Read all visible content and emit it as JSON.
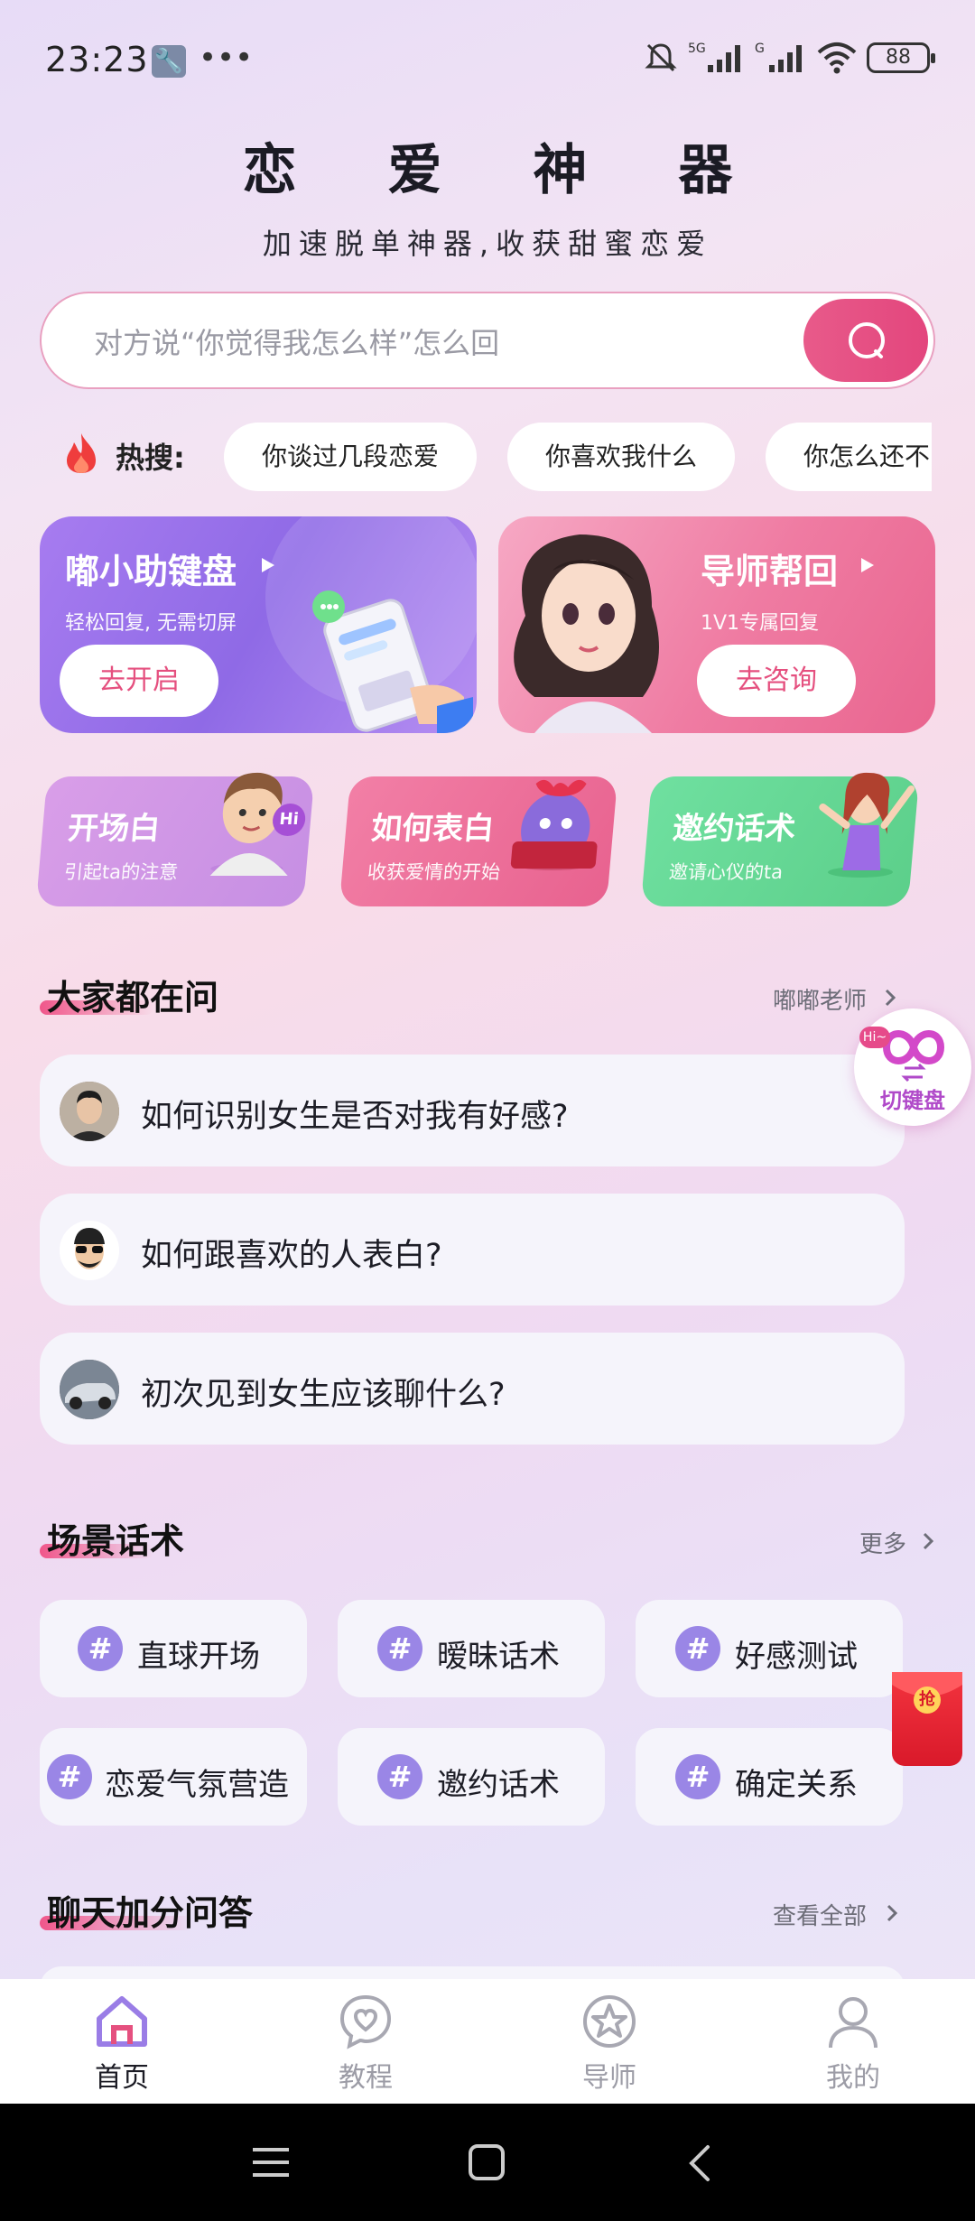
{
  "status": {
    "time": "23:23",
    "battery": "88"
  },
  "header": {
    "title": "恋 爱 神 器",
    "subtitle": "加速脱单神器,收获甜蜜恋爱"
  },
  "search": {
    "placeholder": "对方说“你觉得我怎么样”怎么回"
  },
  "hot": {
    "label": "热搜:",
    "items": [
      "你谈过几段恋爱",
      "你喜欢我什么",
      "你怎么还不"
    ]
  },
  "features": [
    {
      "title": "嘟小助键盘",
      "subtitle": "轻松回复, 无需切屏",
      "button": "去开启"
    },
    {
      "title": "导师帮回",
      "subtitle": "1V1专属回复",
      "button": "去咨询"
    }
  ],
  "mini_cards": [
    {
      "title": "开场白",
      "subtitle": "引起ta的注意",
      "badge": "Hi"
    },
    {
      "title": "如何表白",
      "subtitle": "收获爱情的开始"
    },
    {
      "title": "邀约话术",
      "subtitle": "邀请心仪的ta"
    }
  ],
  "ask": {
    "title": "大家都在问",
    "more": "嘟嘟老师",
    "questions": [
      "如何识别女生是否对我有好感?",
      "如何跟喜欢的人表白?",
      "初次见到女生应该聊什么?"
    ]
  },
  "float_switch": {
    "label": "切键盘",
    "badge": "Hi~"
  },
  "float_redpack": {
    "label": "抢"
  },
  "scenes": {
    "title": "场景话术",
    "more": "更多",
    "items": [
      "直球开场",
      "暧昧话术",
      "好感测试",
      "恋爱气氛营造",
      "邀约话术",
      "确定关系"
    ]
  },
  "qa": {
    "title": "聊天加分问答",
    "more": "查看全部"
  },
  "nav": {
    "items": [
      "首页",
      "教程",
      "导师",
      "我的"
    ],
    "active": "首页"
  },
  "colors": {
    "accent": "#e5507f",
    "purple": "#9a86e6"
  }
}
